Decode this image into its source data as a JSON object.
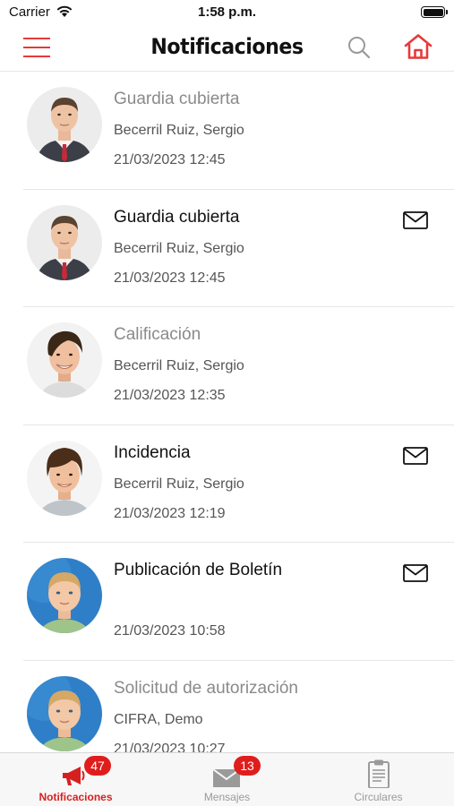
{
  "status_bar": {
    "carrier": "Carrier",
    "time": "1:58 p.m."
  },
  "nav": {
    "title": "Notificaciones"
  },
  "colors": {
    "accent": "#e63a3a",
    "badge": "#e01d1d",
    "read_title": "#8a8a8a",
    "unread_title": "#111111"
  },
  "notifications": [
    {
      "title": "Guardia cubierta",
      "author": "Becerril Ruiz, Sergio",
      "date": "21/03/2023 12:45",
      "read": true,
      "mail_icon": false,
      "avatar": "man-suit"
    },
    {
      "title": "Guardia cubierta",
      "author": "Becerril Ruiz, Sergio",
      "date": "21/03/2023 12:45",
      "read": false,
      "mail_icon": true,
      "avatar": "man-suit"
    },
    {
      "title": "Calificación",
      "author": "Becerril Ruiz, Sergio",
      "date": "21/03/2023 12:35",
      "read": true,
      "mail_icon": false,
      "avatar": "young-man"
    },
    {
      "title": "Incidencia",
      "author": "Becerril Ruiz, Sergio",
      "date": "21/03/2023 12:19",
      "read": false,
      "mail_icon": true,
      "avatar": "boy"
    },
    {
      "title": "Publicación de Boletín",
      "author": "",
      "date": "21/03/2023 10:58",
      "read": false,
      "mail_icon": true,
      "avatar": "child-blue"
    },
    {
      "title": "Solicitud de autorización",
      "author": "CIFRA, Demo",
      "date": "21/03/2023 10:27",
      "read": true,
      "mail_icon": false,
      "avatar": "child-blue"
    }
  ],
  "tabs": [
    {
      "label": "Notificaciones",
      "badge": "47",
      "icon": "megaphone-icon",
      "active": true
    },
    {
      "label": "Mensajes",
      "badge": "13",
      "icon": "envelope-icon",
      "active": false
    },
    {
      "label": "Circulares",
      "badge": "",
      "icon": "clipboard-icon",
      "active": false
    }
  ]
}
